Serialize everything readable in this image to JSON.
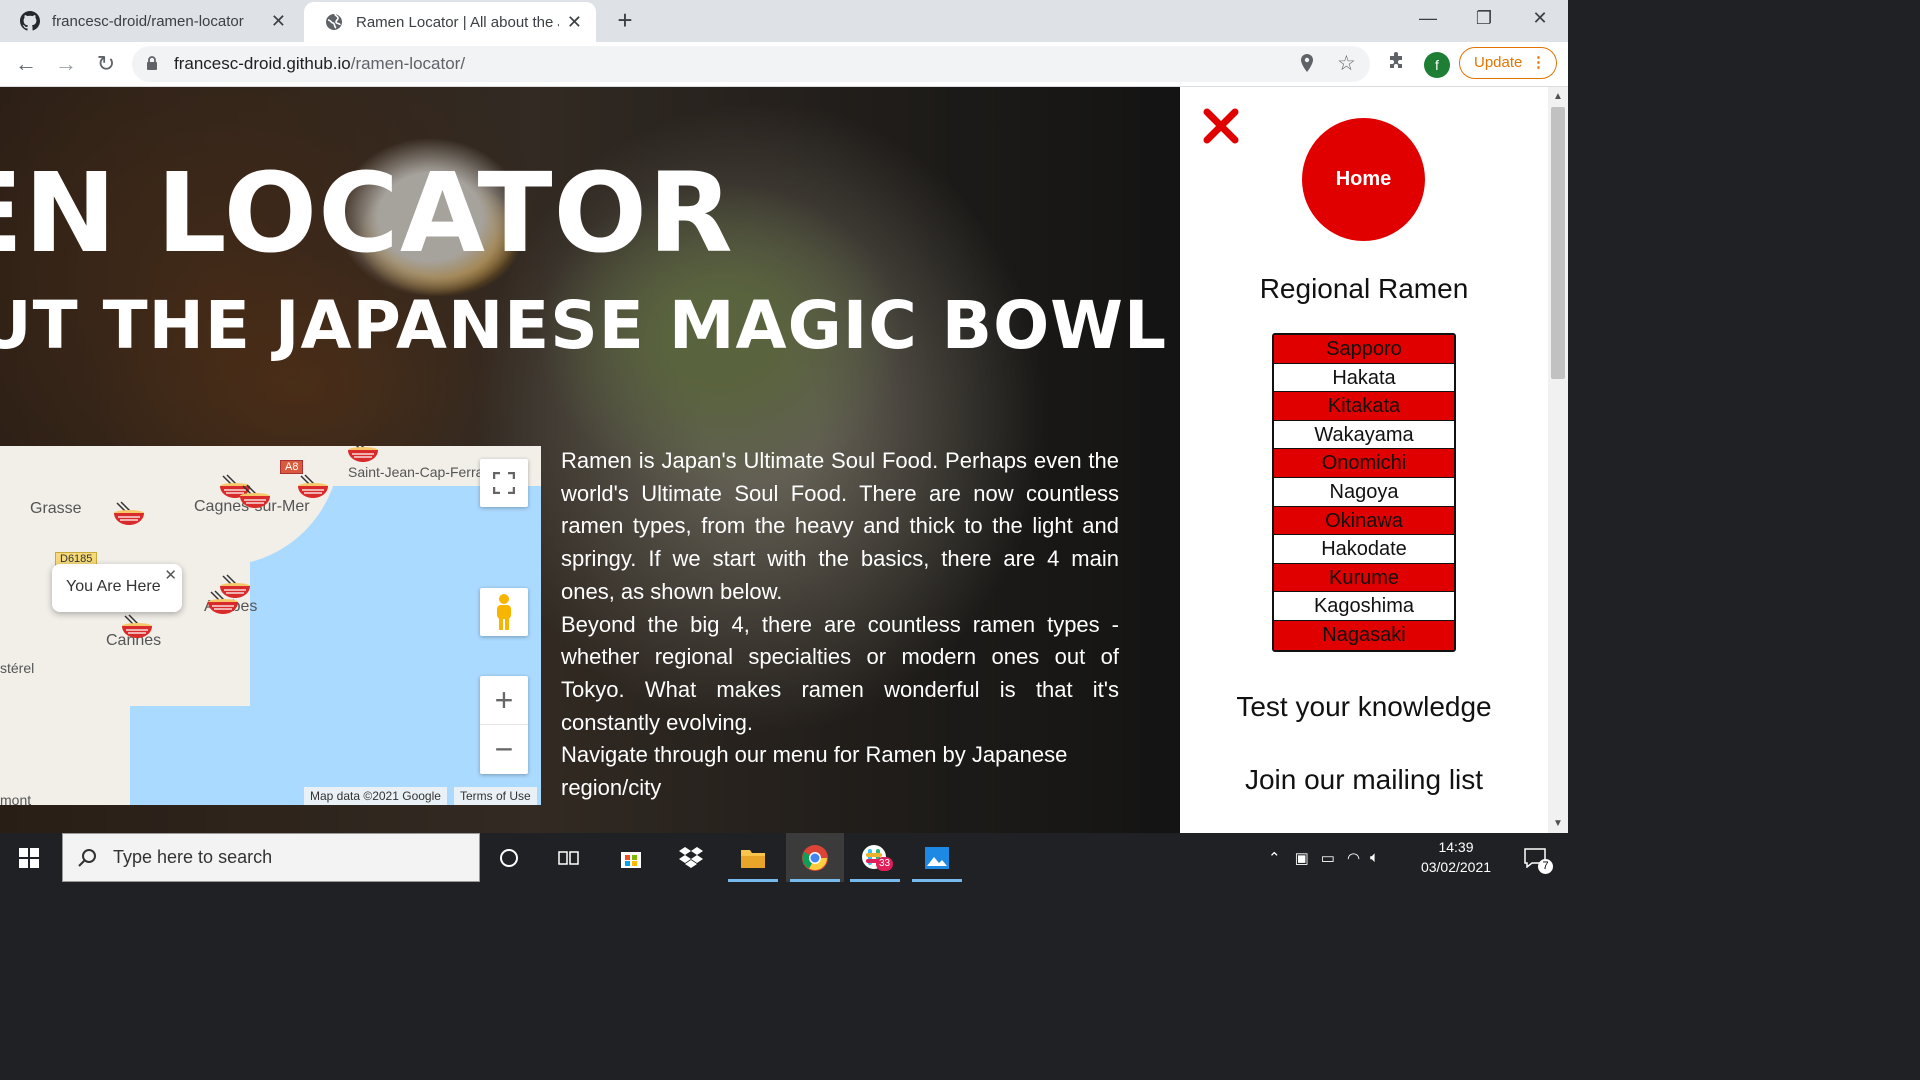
{
  "browser": {
    "tabs": [
      {
        "label": "francesc-droid/ramen-locator",
        "icon": "github-icon"
      },
      {
        "label": "Ramen Locator | All about the Japanese Magic Bowl",
        "icon": "globe-icon"
      }
    ],
    "url_domain": "francesc-droid.github.io",
    "url_path": "/ramen-locator/",
    "profile_initial": "f",
    "update_label": "Update"
  },
  "hero": {
    "title": "RAMEN LOCATOR",
    "subtitle": "ALL ABOUT THE JAPANESE MAGIC BOWL",
    "title_visible": "EN LOCATOR",
    "subtitle_visible": "UT THE JAPANESE MAGIC BOWL"
  },
  "map": {
    "cities": [
      "Grasse",
      "Cagnes-sur-Mer",
      "Saint-Jean-Cap-Ferrat",
      "Antibes",
      "Cannes",
      "stérel",
      "mont"
    ],
    "road_labels": [
      "A8",
      "D6185"
    ],
    "info_window": "You Are Here",
    "attribution": "Map data ©2021 Google",
    "terms": "Terms of Use"
  },
  "intro": {
    "p1": "Ramen is Japan's Ultimate Soul Food. Perhaps even the world's Ultimate Soul Food. There are now countless ramen types, from the heavy and thick to the light and springy. If we start with the basics, there are 4 main ones, as shown below.",
    "p2": "Beyond the big 4, there are countless ramen types - whether regional specialties or modern ones out of Tokyo. What makes ramen wonderful is that it's constantly evolving.",
    "p3": "Navigate through our menu for Ramen by Japanese region/city"
  },
  "sidenav": {
    "home_label": "Home",
    "regional_title": "Regional Ramen",
    "regions": [
      "Sapporo",
      "Hakata",
      "Kitakata",
      "Wakayama",
      "Onomichi",
      "Nagoya",
      "Okinawa",
      "Hakodate",
      "Kurume",
      "Kagoshima",
      "Nagasaki"
    ],
    "quiz_label": "Test your knowledge",
    "mailing_label": "Join our mailing list"
  },
  "taskbar": {
    "search_placeholder": "Type here to search",
    "time": "14:39",
    "date": "03/02/2021",
    "slack_badge": "33",
    "notification_count": "7"
  },
  "colors": {
    "accent_red": "#e10000",
    "update_orange": "#e37400"
  }
}
